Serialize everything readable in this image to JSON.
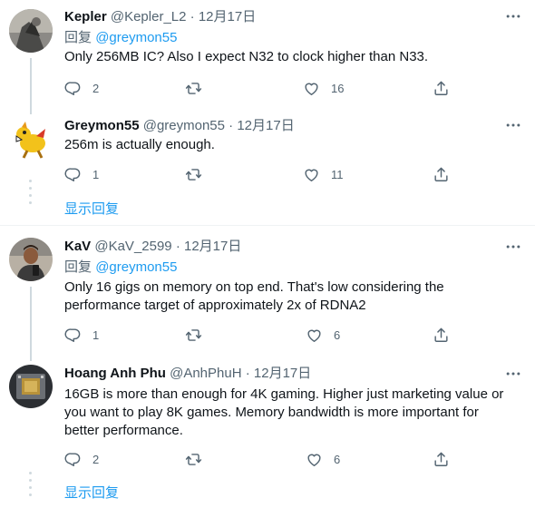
{
  "tweets": [
    {
      "name": "Kepler",
      "handle": "@Kepler_L2",
      "dot": "·",
      "time": "12月17日",
      "reply_label": "回复",
      "reply_mention": "@greymon55",
      "text": "Only 256MB IC? Also I expect N32 to clock higher than N33.",
      "replies": "2",
      "retweets": "",
      "likes": "16"
    },
    {
      "name": "Greymon55",
      "handle": "@greymon55",
      "dot": "·",
      "time": "12月17日",
      "text": "256m is actually enough.",
      "replies": "1",
      "retweets": "",
      "likes": "11",
      "show_replies": "显示回复"
    },
    {
      "name": "KaV",
      "handle": "@KaV_2599",
      "dot": "·",
      "time": "12月17日",
      "reply_label": "回复",
      "reply_mention": "@greymon55",
      "text": "Only 16 gigs on memory on top end. That's low considering the performance target of approximately 2x of RDNA2",
      "replies": "1",
      "retweets": "",
      "likes": "6"
    },
    {
      "name": "Hoang Anh Phu",
      "handle": "@AnhPhuH",
      "dot": "·",
      "time": "12月17日",
      "text": "16GB is more than enough for 4K gaming.  Higher just marketing value or you want to play 8K games.  Memory bandwidth is more important for better performance.",
      "replies": "2",
      "retweets": "",
      "likes": "6",
      "show_replies": "显示回复"
    }
  ],
  "icons": {
    "reply": "reply-icon",
    "retweet": "retweet-icon",
    "like": "heart-icon",
    "share": "share-icon",
    "more": "more-icon"
  },
  "colors": {
    "link": "#1d9bf0",
    "secondary_text": "#536471",
    "thread_line": "#cfd9de"
  }
}
